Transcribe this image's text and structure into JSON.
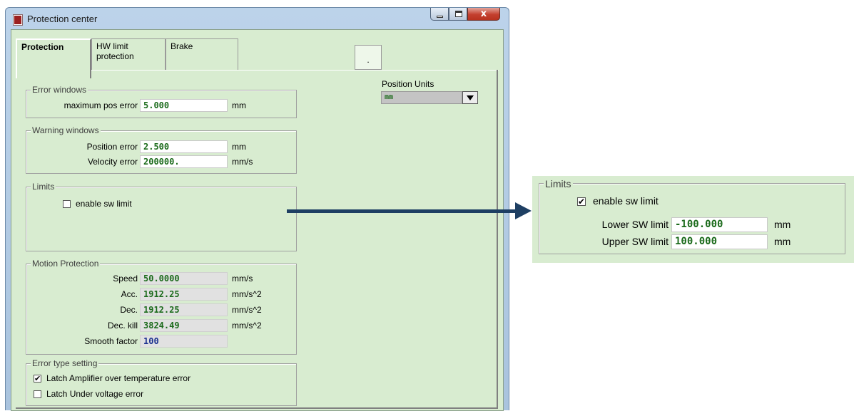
{
  "window": {
    "title": "Protection center",
    "close_glyph": "x"
  },
  "tabs": [
    {
      "label": "Protection",
      "active": true
    },
    {
      "label": "HW limit protection",
      "active": false
    },
    {
      "label": "Brake",
      "active": false
    }
  ],
  "dot_button": {
    "label": "."
  },
  "position_units": {
    "label": "Position Units",
    "value": "mm"
  },
  "error_windows": {
    "title": "Error windows",
    "max_pos_error": {
      "label": "maximum pos error",
      "value": "5.000",
      "unit": "mm"
    }
  },
  "warning_windows": {
    "title": "Warning windows",
    "position_error": {
      "label": "Position error",
      "value": "2.500",
      "unit": "mm"
    },
    "velocity_error": {
      "label": "Velocity error",
      "value": "200000.",
      "unit": "mm/s"
    }
  },
  "limits": {
    "title": "Limits",
    "enable_sw_limit": {
      "label": "enable sw limit",
      "checked": false
    }
  },
  "motion_protection": {
    "title": "Motion Protection",
    "speed": {
      "label": "Speed",
      "value": "50.0000",
      "unit": "mm/s"
    },
    "acc": {
      "label": "Acc.",
      "value": "1912.25",
      "unit": "mm/s^2"
    },
    "dec": {
      "label": "Dec.",
      "value": "1912.25",
      "unit": "mm/s^2"
    },
    "dec_kill": {
      "label": "Dec. kill",
      "value": "3824.49",
      "unit": "mm/s^2"
    },
    "smooth_factor": {
      "label": "Smooth factor",
      "value": "100"
    }
  },
  "error_type": {
    "title": "Error type setting",
    "latch_amp_temp": {
      "label": "Latch Amplifier over temperature error",
      "checked": true
    },
    "latch_under_voltage": {
      "label": "Latch Under voltage error",
      "checked": false
    }
  },
  "zoomed_limits": {
    "title": "Limits",
    "enable_sw_limit": {
      "label": "enable sw limit",
      "checked": true
    },
    "lower_sw_limit": {
      "label": "Lower SW limit",
      "value": "-100.000",
      "unit": "mm"
    },
    "upper_sw_limit": {
      "label": "Upper SW limit",
      "value": "100.000",
      "unit": "mm"
    }
  },
  "check_glyph": "✔",
  "colors": {
    "panel_bg": "#d8ecd0",
    "value_green": "#1c6b1c",
    "value_blue": "#1a2f8f",
    "arrow": "#1e3f63"
  }
}
